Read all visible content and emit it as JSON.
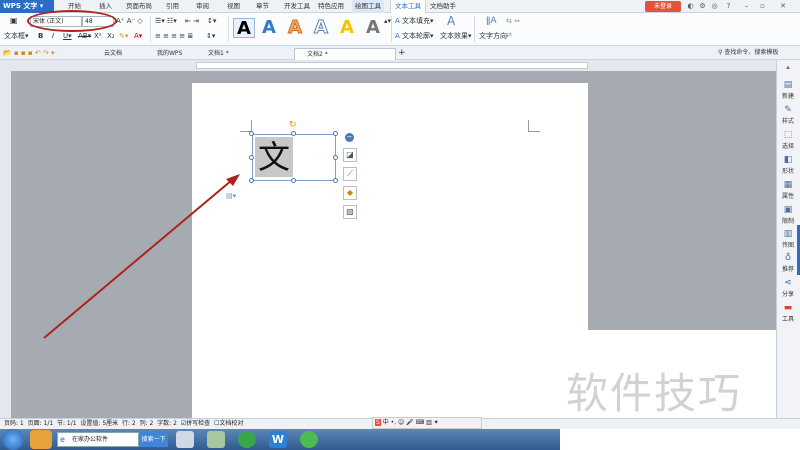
{
  "app": {
    "name": "WPS 文字"
  },
  "menu": {
    "items": [
      "开始",
      "插入",
      "页面布局",
      "引用",
      "审阅",
      "视图",
      "章节",
      "开发工具",
      "特色应用",
      "绘图工具",
      "文本工具",
      "文档助手"
    ],
    "login": "未登录"
  },
  "ribbon": {
    "textbox_label": "文本框",
    "font_name": "宋体 (正文)",
    "font_size": "48",
    "wordart_glyph": "A",
    "text_fill": "文本填充",
    "text_outline": "文本轮廓",
    "text_effect": "文本效果",
    "text_direction": "文字方向",
    "search_command": "查找命令、搜索模板"
  },
  "tabs": {
    "items": [
      {
        "label": "云文档"
      },
      {
        "label": "我的WPS"
      },
      {
        "label": "文档1 *"
      },
      {
        "label": "文档2 *"
      }
    ],
    "add": "+"
  },
  "document": {
    "textbox_char": "文"
  },
  "sidebar": {
    "items": [
      {
        "label": "新建",
        "icon": "new-icon"
      },
      {
        "label": "样式",
        "icon": "style-icon"
      },
      {
        "label": "选择",
        "icon": "select-icon"
      },
      {
        "label": "形状",
        "icon": "shape-icon"
      },
      {
        "label": "属性",
        "icon": "property-icon"
      },
      {
        "label": "限制",
        "icon": "restrict-icon"
      },
      {
        "label": "传图",
        "icon": "upload-image-icon"
      },
      {
        "label": "推荐",
        "icon": "recommend-icon"
      },
      {
        "label": "分享",
        "icon": "share-icon"
      },
      {
        "label": "工具",
        "icon": "tools-icon"
      }
    ]
  },
  "status": {
    "page_num": "页码: 1",
    "pages": "页面: 1/1",
    "section": "节: 1/1",
    "setting": "设置值: 5厘米",
    "row": "行: 2",
    "col": "列: 2",
    "chars": "字数: 2",
    "spell": "拼写检查",
    "proof": "文档校对"
  },
  "taskbar": {
    "search_placeholder": "在家办公软件",
    "search_button": "搜索一下"
  },
  "watermark": "软件技巧",
  "colors": {
    "accent": "#2b6cc4",
    "annotation": "#b0211c",
    "login": "#e2543a"
  }
}
